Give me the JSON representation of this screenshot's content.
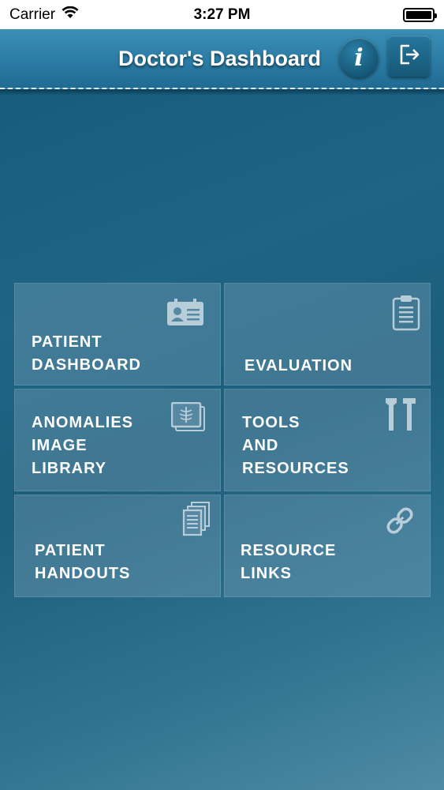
{
  "status_bar": {
    "carrier": "Carrier",
    "time": "3:27 PM",
    "icons": [
      "wifi-icon",
      "battery-icon"
    ]
  },
  "header": {
    "title": "Doctor's Dashboard",
    "info_icon": "info-icon",
    "logout_icon": "logout-icon",
    "info_glyph": "i"
  },
  "tiles": [
    {
      "label": "PATIENT\nDASHBOARD",
      "icon": "id-card-icon"
    },
    {
      "label": "EVALUATION",
      "icon": "clipboard-icon"
    },
    {
      "label": "ANOMALIES\nIMAGE\nLIBRARY",
      "icon": "xray-image-icon"
    },
    {
      "label": "TOOLS\nAND\nRESOURCES",
      "icon": "tools-icon"
    },
    {
      "label": "PATIENT\nHANDOUTS",
      "icon": "documents-icon"
    },
    {
      "label": "RESOURCE\nLINKS",
      "icon": "link-icon"
    }
  ],
  "colors": {
    "background": "#1e6483",
    "nav_bar": "#2a7aa3",
    "tile": "#7fa8bf"
  }
}
